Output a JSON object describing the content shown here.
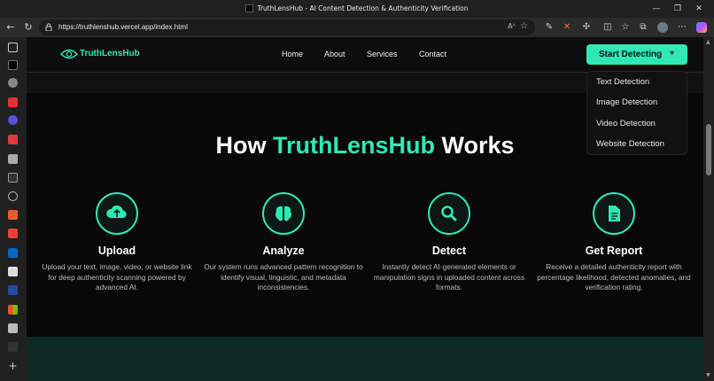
{
  "browser": {
    "tab_title": "TruthLensHub - AI Content Detection & Authenticity Verification",
    "url": "https://truthlenshub.vercel.app/index.html",
    "read_aloud": "Aᴬ",
    "window_controls": [
      "—",
      "❐",
      "✕"
    ]
  },
  "site": {
    "logo_text": "TruthLensHub",
    "nav": [
      "Home",
      "About",
      "Services",
      "Contact"
    ],
    "cta_label": "Start Detecting",
    "cta_caret": "▼",
    "dropdown": [
      "Text Detection",
      "Image Detection",
      "Video Detection",
      "Website Detection"
    ]
  },
  "section": {
    "title_before": "How",
    "title_accent": "TruthLensHub",
    "title_after": "Works",
    "steps": [
      {
        "icon": "upload-icon",
        "title": "Upload",
        "desc": "Upload your text, image, video, or website link for deep authenticity scanning powered by advanced AI."
      },
      {
        "icon": "brain-icon",
        "title": "Analyze",
        "desc": "Our system runs advanced pattern recognition to identify visual, linguistic, and metadata inconsistencies."
      },
      {
        "icon": "search-icon",
        "title": "Detect",
        "desc": "Instantly detect AI-generated elements or manipulation signs in uploaded content across formats."
      },
      {
        "icon": "document-icon",
        "title": "Get Report",
        "desc": "Receive a detailed authenticity report with percentage likelihood, detected anomalies, and verification rating."
      }
    ]
  },
  "colors": {
    "accent": "#2fe8b3",
    "background": "#080808",
    "bottom_band": "#0d2a25"
  }
}
